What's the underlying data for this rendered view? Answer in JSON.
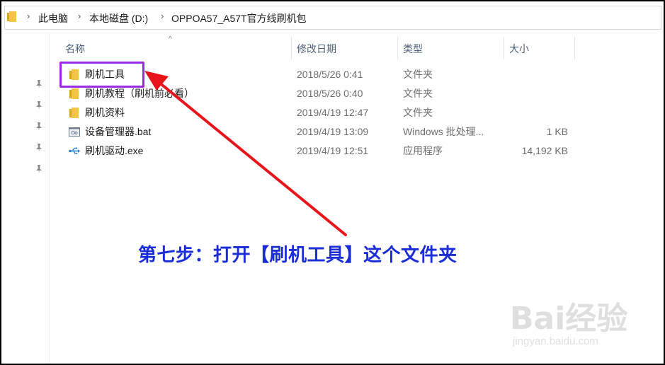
{
  "breadcrumb": {
    "items": [
      "此电脑",
      "本地磁盘 (D:)",
      "OPPOA57_A57T官方线刷机包"
    ]
  },
  "columns": {
    "name": "名称",
    "date": "修改日期",
    "type": "类型",
    "size": "大小"
  },
  "files": [
    {
      "name": "刷机工具",
      "date": "2018/5/26 0:41",
      "type": "文件夹",
      "size": "",
      "icon": "folder-icon"
    },
    {
      "name": "刷机教程（刷机前必看）",
      "date": "2018/5/26 0:40",
      "type": "文件夹",
      "size": "",
      "icon": "folder-icon"
    },
    {
      "name": "刷机资料",
      "date": "2019/4/19 12:47",
      "type": "文件夹",
      "size": "",
      "icon": "folder-icon"
    },
    {
      "name": "设备管理器.bat",
      "date": "2019/4/19 13:09",
      "type": "Windows 批处理...",
      "size": "1 KB",
      "icon": "bat-file-icon"
    },
    {
      "name": "刷机驱动.exe",
      "date": "2019/4/19 12:51",
      "type": "应用程序",
      "size": "14,192 KB",
      "icon": "usb-exe-icon"
    }
  ],
  "annotation": {
    "instruction": "第七步：打开【刷机工具】这个文件夹",
    "highlight_color": "#9b2be6",
    "arrow_color": "#e8141c",
    "text_color": "#1a2dd6"
  },
  "watermark": {
    "brand": "Bai经验",
    "url": "jingyan.baidu.com"
  },
  "colors": {
    "folder": "#f4c542",
    "header_text": "#4c607a",
    "secondary_text": "#6d6d6d"
  }
}
